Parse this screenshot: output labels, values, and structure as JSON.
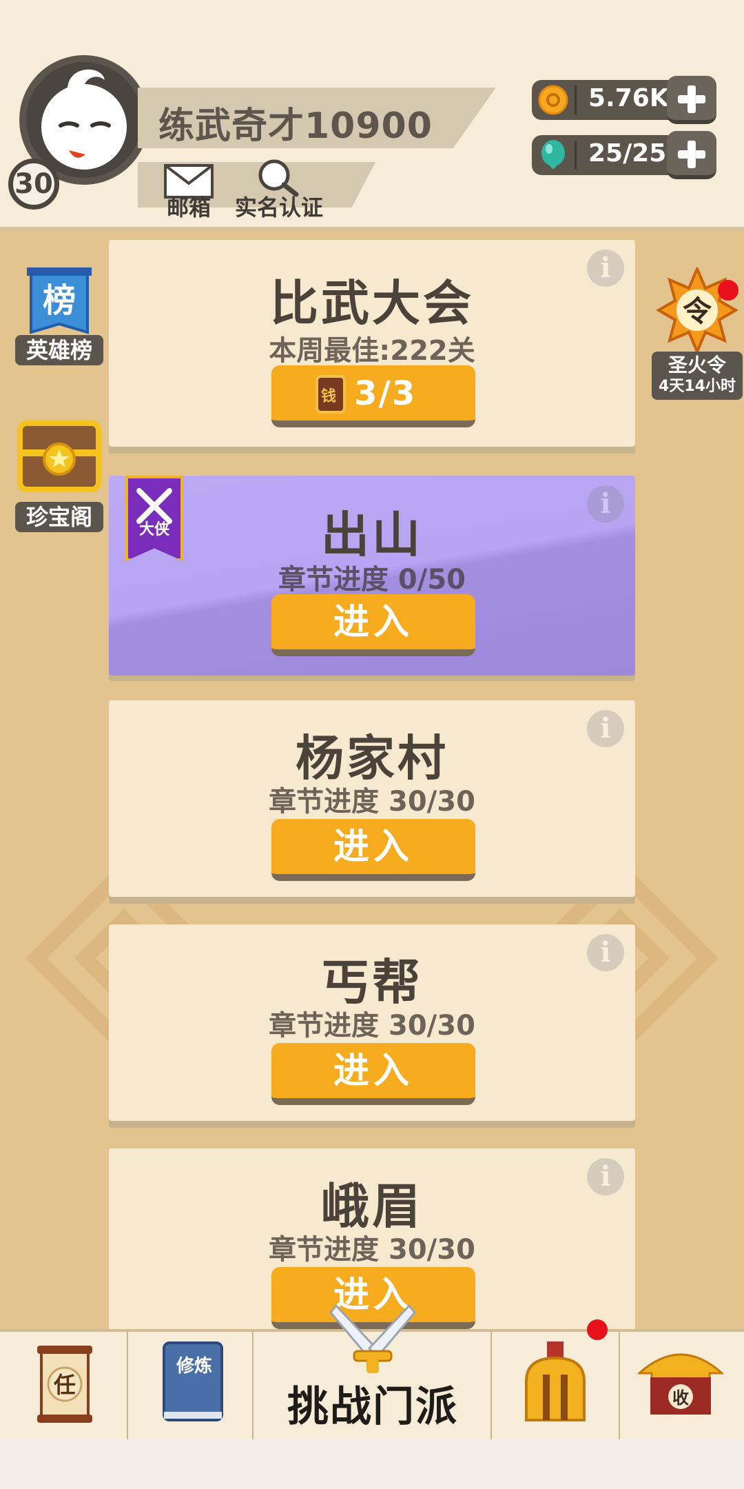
{
  "header": {
    "player_name": "练武奇才10900",
    "level": "30",
    "mailbox_label": "邮箱",
    "realname_label": "实名认证"
  },
  "resources": [
    {
      "name": "coin",
      "icon": "coin-icon",
      "value": "5.76K"
    },
    {
      "name": "stamina",
      "icon": "teal-drop-icon",
      "value": "25/25"
    }
  ],
  "side_left": [
    {
      "label": "英雄榜",
      "icon": "banner-icon",
      "icon_text": "榜"
    },
    {
      "label": "珍宝阁",
      "icon": "treasure-chest-icon"
    }
  ],
  "side_right": {
    "label": "圣火令",
    "timer": "4天14小时",
    "icon_text": "令"
  },
  "cards": [
    {
      "title": "比武大会",
      "sub": "本周最佳:222关",
      "button": "3/3",
      "button_icon_text": "钱",
      "type": "normal"
    },
    {
      "title": "出山",
      "sub": "章节进度 0/50",
      "button": "进入",
      "ribbon": "大侠",
      "type": "purple"
    },
    {
      "title": "杨家村",
      "sub": "章节进度 30/30",
      "button": "进入",
      "type": "normal"
    },
    {
      "title": "丐帮",
      "sub": "章节进度 30/30",
      "button": "进入",
      "type": "normal"
    },
    {
      "title": "峨眉",
      "sub": "章节进度 30/30",
      "button": "进入",
      "type": "normal"
    }
  ],
  "bottom_nav": {
    "task_icon_text": "任",
    "training_icon_text": "修炼",
    "center_label": "挑战门派",
    "shop_icon_text": "收"
  },
  "colors": {
    "background": "#e3c48e",
    "card": "#f7e9d0",
    "button": "#f7ab1f",
    "purple_card": "#b7a4f2",
    "notification": "#e8101a"
  }
}
